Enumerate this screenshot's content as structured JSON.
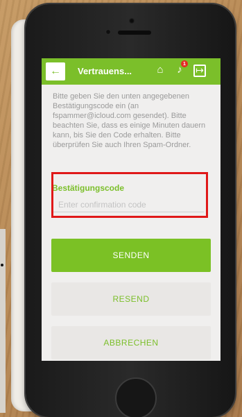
{
  "app_bar": {
    "back_icon": "←",
    "title": "Vertrauens...",
    "home_icon": "⌂",
    "bell_icon": "♪",
    "notification_count": "1",
    "logout_icon": "↦"
  },
  "content": {
    "info_text": "Bitte geben Sie den unten angegebenen Bestätigungscode ein (an fspammer@icloud.com gesendet). Bitte beachten Sie, dass es einige Minuten dauern kann, bis Sie den Code erhalten. Bitte überprüfen Sie auch Ihren Spam-Ordner.",
    "field_label": "Bestätigungscode",
    "field_placeholder": "Enter confirmation code",
    "field_value": ""
  },
  "buttons": {
    "send": "SENDEN",
    "resend": "RESEND",
    "cancel": "ABBRECHEN"
  },
  "colors": {
    "accent": "#7bbf2a",
    "highlight": "#e01818",
    "badge": "#e32b24"
  }
}
